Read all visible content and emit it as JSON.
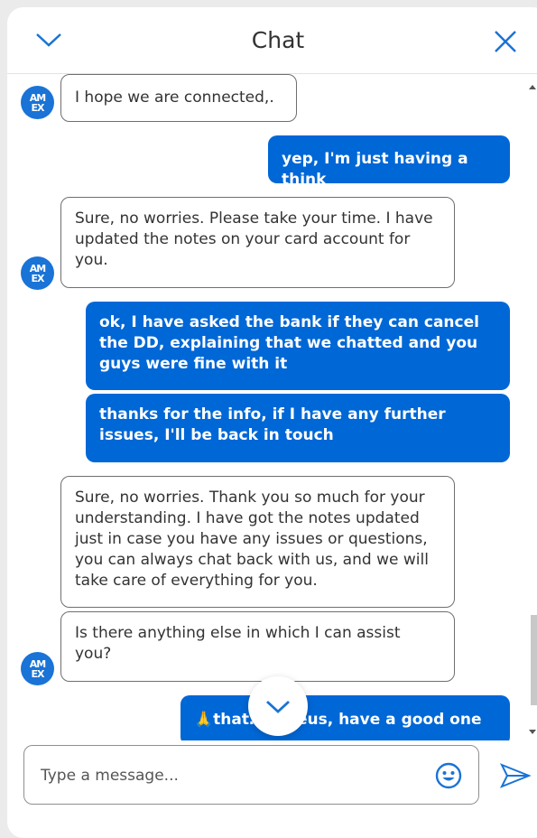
{
  "header": {
    "title": "Chat",
    "collapse_icon": "chevron-down-icon",
    "close_icon": "close-icon"
  },
  "avatar": {
    "label_line1": "AM",
    "label_line2": "EX"
  },
  "messages": [
    {
      "sender": "agent",
      "text": "I hope we are connected,."
    },
    {
      "sender": "user",
      "text": "yep, I'm just having a think"
    },
    {
      "sender": "agent",
      "text": "Sure, no worries. Please take your time. I have updated the notes on your card account for you."
    },
    {
      "sender": "user",
      "text": "ok, I have asked the bank if they can cancel the DD, explaining that we chatted and you guys were fine with it"
    },
    {
      "sender": "user",
      "text": "thanks for the info, if I have any further issues, I'll be back in touch"
    },
    {
      "sender": "agent",
      "text": "Sure, no worries. Thank you so much for your understanding. I have got the notes updated just in case you have any issues or questions, you can always chat back with us, and we will take care of everything for you."
    },
    {
      "sender": "agent",
      "text": "Is there anything else in which I can assist you?"
    },
    {
      "sender": "user",
      "text": "🙏that… erseus, have a good one"
    }
  ],
  "composer": {
    "placeholder": "Type a message...",
    "emoji_icon": "emoji-icon",
    "send_icon": "send-icon"
  },
  "colors": {
    "user_bubble": "#0067d6",
    "accent": "#1a73d6"
  }
}
